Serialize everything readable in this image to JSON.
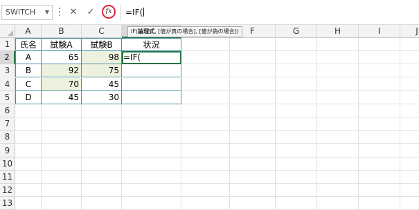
{
  "formula_bar": {
    "name_box": "SWITCH",
    "cancel_symbol": "✕",
    "enter_symbol": "✓",
    "fx_label": "fx",
    "formula": "=IF("
  },
  "tooltip": {
    "func": "IF(",
    "arg1": "論理式",
    "rest": ", [値が真の場合], [値が偽の場合])"
  },
  "columns": [
    "A",
    "B",
    "C",
    "D",
    "E",
    "F",
    "G",
    "H",
    "I",
    "J"
  ],
  "rows": [
    "1",
    "2",
    "3",
    "4",
    "5",
    "6",
    "7",
    "8",
    "9",
    "10",
    "11",
    "12",
    "13"
  ],
  "table": {
    "headers": [
      "氏名",
      "試験A",
      "試験B",
      "状況"
    ],
    "data": [
      [
        "A",
        "65",
        "98",
        "=IF("
      ],
      [
        "B",
        "92",
        "75",
        ""
      ],
      [
        "C",
        "70",
        "45",
        ""
      ],
      [
        "D",
        "45",
        "30",
        ""
      ]
    ]
  },
  "colors": {
    "accent": "#217346",
    "fx_circle": "#d9263b",
    "table_border": "#4a90a4",
    "shade": "#edf2df"
  }
}
